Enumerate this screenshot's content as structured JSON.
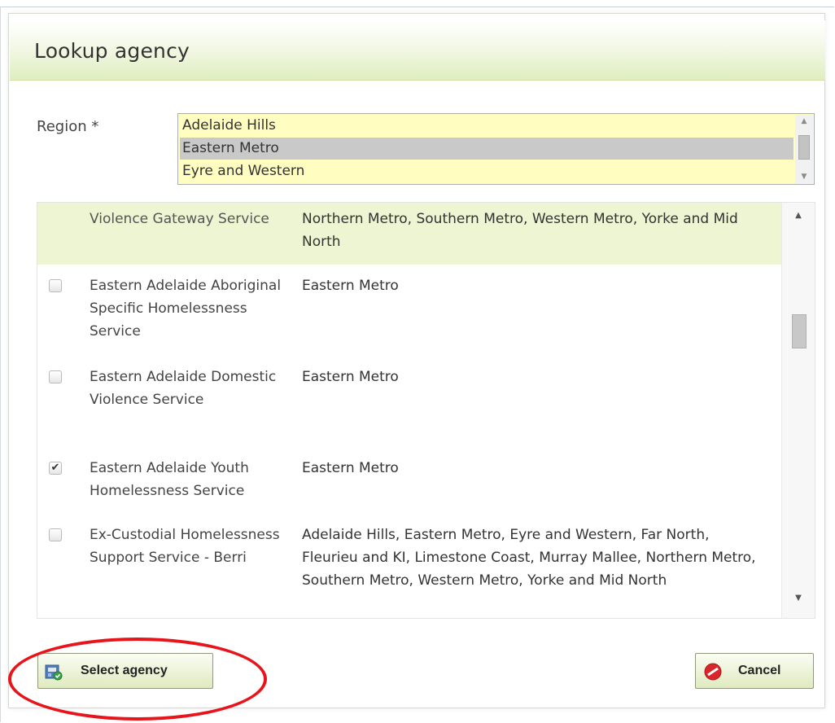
{
  "dialog": {
    "title": "Lookup agency"
  },
  "region": {
    "label": "Region *",
    "options": [
      "Adelaide Hills",
      "Eastern Metro",
      "Eyre and Western"
    ],
    "selected": "Eastern Metro"
  },
  "agencies": [
    {
      "name": "Violence Gateway Service",
      "regions": "Northern Metro, Southern Metro, Western Metro, Yorke and Mid North",
      "checked": false,
      "checkbox_visible": false
    },
    {
      "name": "Eastern Adelaide Aboriginal Specific Homelessness Service",
      "regions": "Eastern Metro",
      "checked": false,
      "checkbox_visible": true
    },
    {
      "name": "Eastern Adelaide Domestic Violence Service",
      "regions": "Eastern Metro",
      "checked": false,
      "checkbox_visible": true
    },
    {
      "name": "Eastern Adelaide Youth Homelessness Service",
      "regions": "Eastern Metro",
      "checked": true,
      "checkbox_visible": true
    },
    {
      "name": "Ex-Custodial Homelessness Support Service - Berri",
      "regions": "Adelaide Hills, Eastern Metro, Eyre and Western, Far North, Fleurieu and KI, Limestone Coast, Murray Mallee, Northern Metro, Southern Metro, Western Metro, Yorke and Mid North",
      "checked": false,
      "checkbox_visible": true
    }
  ],
  "buttons": {
    "select_label": "Select agency",
    "cancel_label": "Cancel"
  },
  "colors": {
    "accent_green": "#dfeec0",
    "row_highlight": "#eef5d2",
    "listbox_bg": "#fffdbf",
    "annotation_red": "#e8141b",
    "cancel_red": "#d9262a"
  },
  "icons": {
    "checked_glyph": "✔",
    "scroll_up": "▲",
    "scroll_down": "▼"
  }
}
